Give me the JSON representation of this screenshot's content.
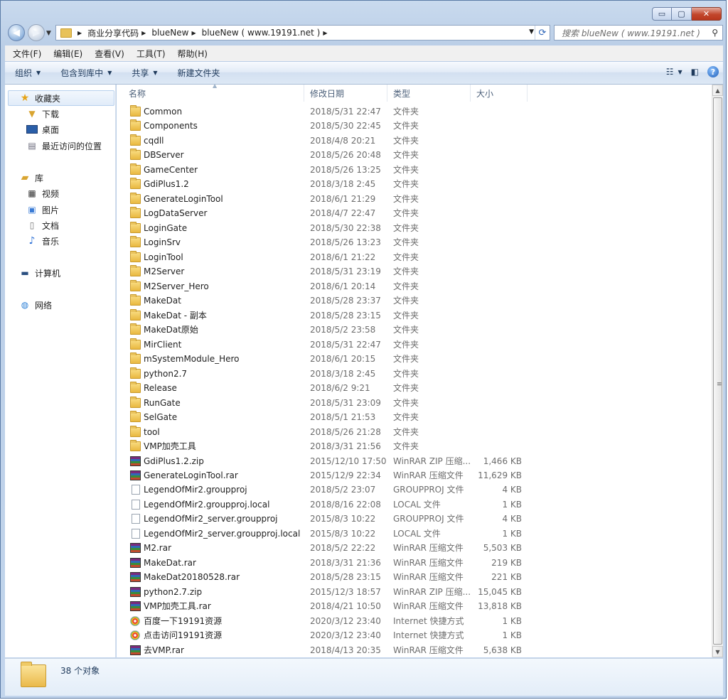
{
  "window": {
    "controls": {
      "minimize": "▭",
      "maximize": "▢",
      "close": "✕"
    }
  },
  "address": {
    "crumbs": [
      "商业分享代码",
      "blueNew",
      "blueNew ( www.19191.net )"
    ]
  },
  "search": {
    "placeholder": "搜索 blueNew ( www.19191.net )"
  },
  "menu": [
    "文件(F)",
    "编辑(E)",
    "查看(V)",
    "工具(T)",
    "帮助(H)"
  ],
  "toolbar": {
    "organize": "组织",
    "include_library": "包含到库中",
    "share": "共享",
    "new_folder": "新建文件夹"
  },
  "nav": {
    "favorites": "收藏夹",
    "downloads": "下载",
    "desktop": "桌面",
    "recent": "最近访问的位置",
    "libraries": "库",
    "videos": "视频",
    "pictures": "图片",
    "documents": "文档",
    "music": "音乐",
    "computer": "计算机",
    "network": "网络"
  },
  "columns": {
    "name": "名称",
    "date": "修改日期",
    "type": "类型",
    "size": "大小"
  },
  "files": [
    {
      "icon": "folder",
      "name": "Common",
      "date": "2018/5/31 22:47",
      "type": "文件夹",
      "size": ""
    },
    {
      "icon": "folder",
      "name": "Components",
      "date": "2018/5/30 22:45",
      "type": "文件夹",
      "size": ""
    },
    {
      "icon": "folder",
      "name": "cqdll",
      "date": "2018/4/8 20:21",
      "type": "文件夹",
      "size": ""
    },
    {
      "icon": "folder",
      "name": "DBServer",
      "date": "2018/5/26 20:48",
      "type": "文件夹",
      "size": ""
    },
    {
      "icon": "folder",
      "name": "GameCenter",
      "date": "2018/5/26 13:25",
      "type": "文件夹",
      "size": ""
    },
    {
      "icon": "folder",
      "name": "GdiPlus1.2",
      "date": "2018/3/18 2:45",
      "type": "文件夹",
      "size": ""
    },
    {
      "icon": "folder",
      "name": "GenerateLoginTool",
      "date": "2018/6/1 21:29",
      "type": "文件夹",
      "size": ""
    },
    {
      "icon": "folder",
      "name": "LogDataServer",
      "date": "2018/4/7 22:47",
      "type": "文件夹",
      "size": ""
    },
    {
      "icon": "folder",
      "name": "LoginGate",
      "date": "2018/5/30 22:38",
      "type": "文件夹",
      "size": ""
    },
    {
      "icon": "folder",
      "name": "LoginSrv",
      "date": "2018/5/26 13:23",
      "type": "文件夹",
      "size": ""
    },
    {
      "icon": "folder",
      "name": "LoginTool",
      "date": "2018/6/1 21:22",
      "type": "文件夹",
      "size": ""
    },
    {
      "icon": "folder",
      "name": "M2Server",
      "date": "2018/5/31 23:19",
      "type": "文件夹",
      "size": ""
    },
    {
      "icon": "folder",
      "name": "M2Server_Hero",
      "date": "2018/6/1 20:14",
      "type": "文件夹",
      "size": ""
    },
    {
      "icon": "folder",
      "name": "MakeDat",
      "date": "2018/5/28 23:37",
      "type": "文件夹",
      "size": ""
    },
    {
      "icon": "folder",
      "name": "MakeDat - 副本",
      "date": "2018/5/28 23:15",
      "type": "文件夹",
      "size": ""
    },
    {
      "icon": "folder",
      "name": "MakeDat原始",
      "date": "2018/5/2 23:58",
      "type": "文件夹",
      "size": ""
    },
    {
      "icon": "folder",
      "name": "MirClient",
      "date": "2018/5/31 22:47",
      "type": "文件夹",
      "size": ""
    },
    {
      "icon": "folder",
      "name": "mSystemModule_Hero",
      "date": "2018/6/1 20:15",
      "type": "文件夹",
      "size": ""
    },
    {
      "icon": "folder",
      "name": "python2.7",
      "date": "2018/3/18 2:45",
      "type": "文件夹",
      "size": ""
    },
    {
      "icon": "folder",
      "name": "Release",
      "date": "2018/6/2 9:21",
      "type": "文件夹",
      "size": ""
    },
    {
      "icon": "folder",
      "name": "RunGate",
      "date": "2018/5/31 23:09",
      "type": "文件夹",
      "size": ""
    },
    {
      "icon": "folder",
      "name": "SelGate",
      "date": "2018/5/1 21:53",
      "type": "文件夹",
      "size": ""
    },
    {
      "icon": "folder",
      "name": "tool",
      "date": "2018/5/26 21:28",
      "type": "文件夹",
      "size": ""
    },
    {
      "icon": "folder",
      "name": "VMP加壳工具",
      "date": "2018/3/31 21:56",
      "type": "文件夹",
      "size": ""
    },
    {
      "icon": "archive",
      "name": "GdiPlus1.2.zip",
      "date": "2015/12/10 17:50",
      "type": "WinRAR ZIP 压缩...",
      "size": "1,466 KB"
    },
    {
      "icon": "archive",
      "name": "GenerateLoginTool.rar",
      "date": "2015/12/9 22:34",
      "type": "WinRAR 压缩文件",
      "size": "11,629 KB"
    },
    {
      "icon": "doc",
      "name": "LegendOfMir2.groupproj",
      "date": "2018/5/2 23:07",
      "type": "GROUPPROJ 文件",
      "size": "4 KB"
    },
    {
      "icon": "doc",
      "name": "LegendOfMir2.groupproj.local",
      "date": "2018/8/16 22:08",
      "type": "LOCAL 文件",
      "size": "1 KB"
    },
    {
      "icon": "doc",
      "name": "LegendOfMir2_server.groupproj",
      "date": "2015/8/3 10:22",
      "type": "GROUPPROJ 文件",
      "size": "4 KB"
    },
    {
      "icon": "doc",
      "name": "LegendOfMir2_server.groupproj.local",
      "date": "2015/8/3 10:22",
      "type": "LOCAL 文件",
      "size": "1 KB"
    },
    {
      "icon": "archive",
      "name": "M2.rar",
      "date": "2018/5/2 22:22",
      "type": "WinRAR 压缩文件",
      "size": "5,503 KB"
    },
    {
      "icon": "archive",
      "name": "MakeDat.rar",
      "date": "2018/3/31 21:36",
      "type": "WinRAR 压缩文件",
      "size": "219 KB"
    },
    {
      "icon": "archive",
      "name": "MakeDat20180528.rar",
      "date": "2018/5/28 23:15",
      "type": "WinRAR 压缩文件",
      "size": "221 KB"
    },
    {
      "icon": "archive",
      "name": "python2.7.zip",
      "date": "2015/12/3 18:57",
      "type": "WinRAR ZIP 压缩...",
      "size": "15,045 KB"
    },
    {
      "icon": "archive",
      "name": "VMP加壳工具.rar",
      "date": "2018/4/21 10:50",
      "type": "WinRAR 压缩文件",
      "size": "13,818 KB"
    },
    {
      "icon": "link",
      "name": "百度一下19191资源",
      "date": "2020/3/12 23:40",
      "type": "Internet 快捷方式",
      "size": "1 KB"
    },
    {
      "icon": "link",
      "name": "点击访问19191资源",
      "date": "2020/3/12 23:40",
      "type": "Internet 快捷方式",
      "size": "1 KB"
    },
    {
      "icon": "archive",
      "name": "去VMP.rar",
      "date": "2018/4/13 20:35",
      "type": "WinRAR 压缩文件",
      "size": "5,638 KB"
    }
  ],
  "status": {
    "count_text": "38 个对象"
  }
}
